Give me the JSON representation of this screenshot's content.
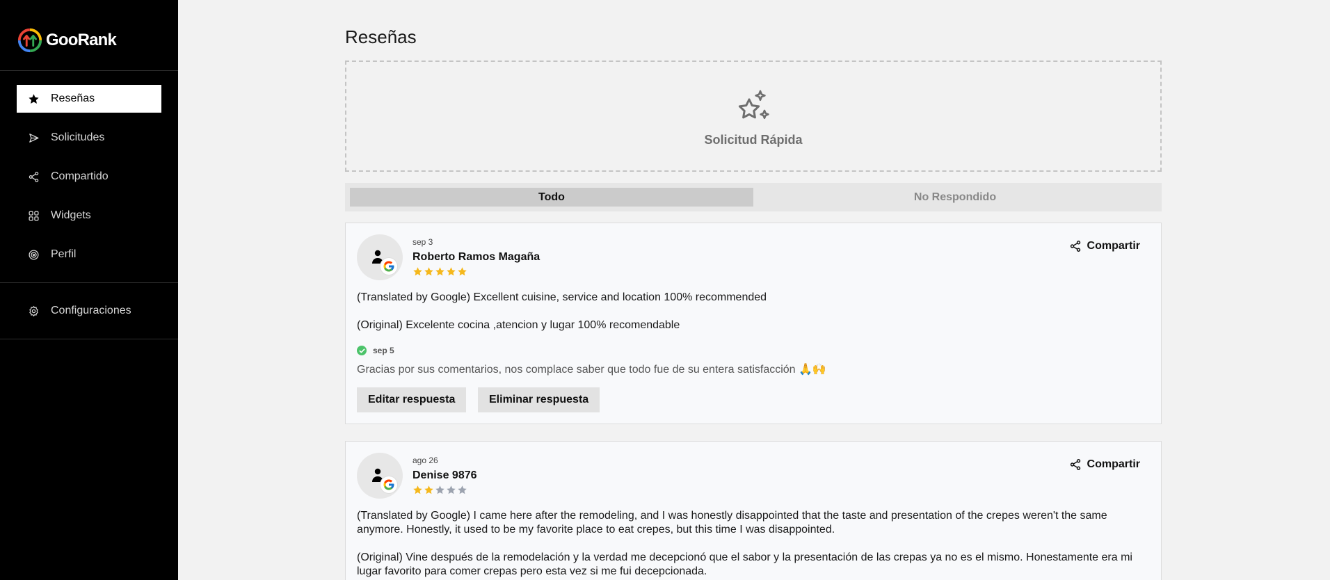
{
  "app": {
    "name": "GooRank"
  },
  "sidebar": {
    "items": [
      {
        "label": "Reseñas"
      },
      {
        "label": "Solicitudes"
      },
      {
        "label": "Compartido"
      },
      {
        "label": "Widgets"
      },
      {
        "label": "Perfil"
      }
    ],
    "settings": {
      "label": "Configuraciones"
    }
  },
  "main": {
    "title": "Reseñas",
    "quick_request": {
      "label": "Solicitud Rápida"
    },
    "tabs": [
      {
        "label": "Todo",
        "active": true
      },
      {
        "label": "No Respondido",
        "active": false
      }
    ],
    "reviews": [
      {
        "date": "sep 3",
        "author": "Roberto Ramos Magaña",
        "rating": 5,
        "translated": "(Translated by Google) Excellent cuisine, service and location 100% recommended",
        "original": "(Original) Excelente cocina ,atencion y lugar 100% recomendable",
        "reply": {
          "date": "sep 5",
          "text": "Gracias por sus comentarios, nos complace saber que todo fue de su entera satisfacción 🙏🙌"
        },
        "share_label": "Compartir",
        "edit_label": "Editar respuesta",
        "delete_label": "Eliminar respuesta"
      },
      {
        "date": "ago 26",
        "author": "Denise 9876",
        "rating": 2,
        "translated": "(Translated by Google) I came here after the remodeling, and I was honestly disappointed that the taste and presentation of the crepes weren't the same anymore. Honestly, it used to be my favorite place to eat crepes, but this time I was disappointed.",
        "original": "(Original) Vine después de la remodelación y la verdad me decepcionó que el sabor y la presentación de las crepas ya no es el mismo. Honestamente era mi lugar favorito para comer crepas pero esta vez si me fui decepcionada.",
        "share_label": "Compartir"
      }
    ]
  },
  "colors": {
    "sidebar_bg": "#000000",
    "star_filled": "#f5b81c",
    "star_empty": "#9ca3af",
    "reply_check": "#4cc36a"
  }
}
